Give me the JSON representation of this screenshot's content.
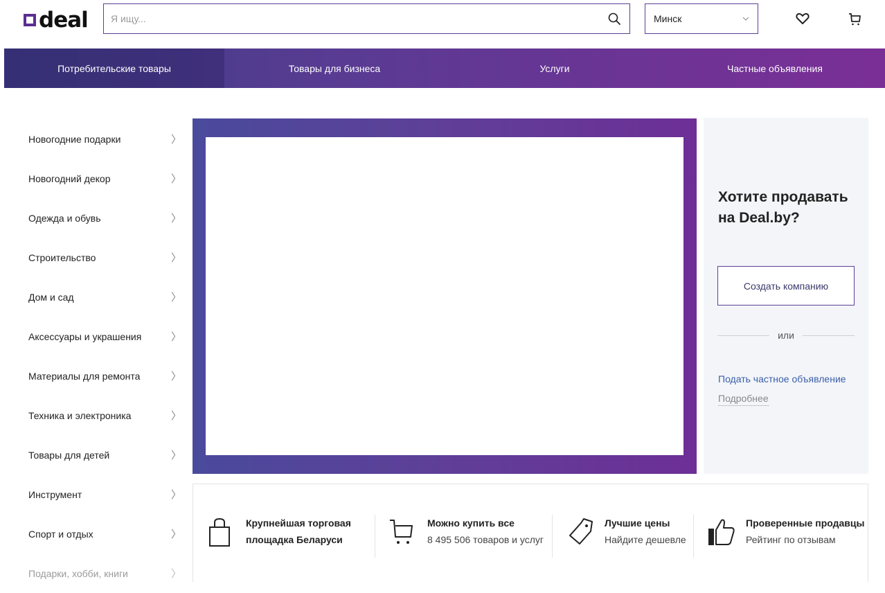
{
  "header": {
    "logo_text": "deal",
    "search_placeholder": "Я ищу...",
    "city": "Минск",
    "icons": [
      "search-icon",
      "chevron-down-icon",
      "heart-icon",
      "cart-icon"
    ]
  },
  "nav": {
    "items": [
      {
        "label": "Потребительские товары"
      },
      {
        "label": "Товары для бизнеса"
      },
      {
        "label": "Услуги"
      },
      {
        "label": "Частные объявления"
      }
    ]
  },
  "sidebar": {
    "items": [
      {
        "label": "Новогодние подарки"
      },
      {
        "label": "Новогодний декор"
      },
      {
        "label": "Одежда и обувь"
      },
      {
        "label": "Строительство"
      },
      {
        "label": "Дом и сад"
      },
      {
        "label": "Аксессуары и украшения"
      },
      {
        "label": "Материалы для ремонта"
      },
      {
        "label": "Техника и электроника"
      },
      {
        "label": "Товары для детей"
      },
      {
        "label": "Инструмент"
      },
      {
        "label": "Спорт и отдых"
      },
      {
        "label": "Подарки, хобби, книги"
      }
    ]
  },
  "sell": {
    "title": "Хотите продавать на Deal.by?",
    "create_button": "Создать компанию",
    "or": "или",
    "private_ad_link": "Подать частное объявление",
    "more_link": "Подробнее"
  },
  "features": [
    {
      "title": "Крупнейшая торговая площадка Беларуси",
      "subtitle": "",
      "icon": "bag-icon"
    },
    {
      "title": "Можно купить все",
      "subtitle": "8 495 506 товаров и услуг",
      "icon": "cart-icon"
    },
    {
      "title": "Лучшие цены",
      "subtitle": "Найдите дешевле",
      "icon": "price-tag-icon"
    },
    {
      "title": "Проверенные продавцы",
      "subtitle": "Рейтинг по отзывам",
      "icon": "thumbs-up-icon"
    }
  ],
  "colors": {
    "brand": "#5b2f91",
    "nav_gradient_start": "#3f3d86",
    "nav_gradient_end": "#7a2f96",
    "link": "#3a5ea8",
    "sell_panel_bg": "#f3f5f9"
  }
}
